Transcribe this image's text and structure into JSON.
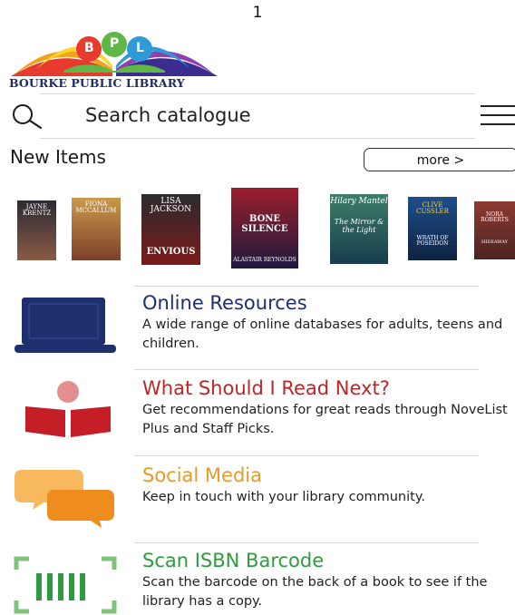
{
  "status_bar": {
    "page_indicator": "1"
  },
  "logo": {
    "letters": [
      "B",
      "P",
      "L"
    ],
    "name": "BOURKE PUBLIC LIBRARY"
  },
  "search": {
    "placeholder": "Search catalogue",
    "value": ""
  },
  "new_items": {
    "title": "New Items",
    "more_label": "more >",
    "covers": [
      {
        "author": "JAYNE KRENTZ",
        "title": "",
        "colors": [
          "#2c2a33",
          "#8a5b45"
        ]
      },
      {
        "author": "FIONA MCCALLUM",
        "title": "",
        "colors": [
          "#c99a4a",
          "#7d3f2b"
        ]
      },
      {
        "author": "LISA JACKSON",
        "title": "ENVIOUS",
        "colors": [
          "#2b2b2e",
          "#7b1b1b"
        ]
      },
      {
        "author": "ALASTAIR REYNOLDS",
        "title": "BONE SILENCE",
        "colors": [
          "#9b1f2c",
          "#1d1a3d"
        ]
      },
      {
        "author": "Hilary Mantel",
        "title": "The Mirror & the Light",
        "colors": [
          "#3f7d6a",
          "#163d4c"
        ]
      },
      {
        "author": "CLIVE CUSSLER",
        "title": "WRATH OF POSEIDON",
        "colors": [
          "#1e4e8c",
          "#0f2240"
        ]
      },
      {
        "author": "NORA ROBERTS",
        "title": "HIDEAWAY",
        "colors": [
          "#8c3a32",
          "#4a2422"
        ]
      }
    ]
  },
  "features": [
    {
      "icon": "laptop-icon",
      "title": "Online Resources",
      "description": "A wide range of online databases for adults, teens and children.",
      "title_color": "#1e2f6e"
    },
    {
      "icon": "reader-icon",
      "title": "What Should I Read Next?",
      "description": "Get recommendations for great reads through NoveList Plus and Staff Picks.",
      "title_color": "#b8282a"
    },
    {
      "icon": "chat-bubbles-icon",
      "title": "Social Media",
      "description": "Keep in touch with your library community.",
      "title_color": "#e89a2a"
    },
    {
      "icon": "barcode-icon",
      "title": "Scan ISBN Barcode",
      "description": "Scan the barcode on the back of a book to see if the library has a copy.",
      "title_color": "#2f9a3f"
    }
  ],
  "colors": {
    "navy": "#1e2f6e",
    "red": "#b8282a",
    "orange": "#e89a2a",
    "green": "#2f9a3f",
    "divider": "#d9d9d9"
  }
}
